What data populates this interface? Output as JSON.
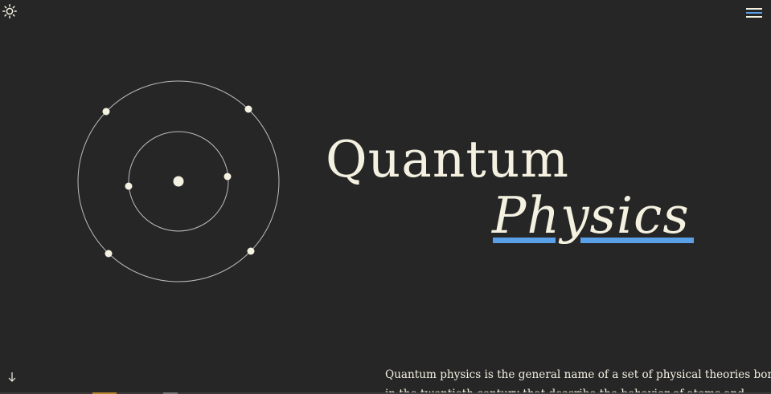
{
  "header": {
    "theme_toggle_icon": "sun-icon",
    "menu_icon": "hamburger-menu-icon"
  },
  "hero": {
    "title_line1": "Quantum",
    "title_line2": "Physics",
    "illustration_icon": "atom-orbit-icon",
    "scroll_icon": "arrow-down-icon"
  },
  "intro": {
    "line1": "Quantum physics is the general name of a set of physical theories born",
    "line2": "in the twentieth century that describe the behavior of atoms and"
  },
  "colors": {
    "background": "#262626",
    "text": "#f4f1e1",
    "accent": "#5aa0e6",
    "orbit": "#bdbdbd"
  }
}
